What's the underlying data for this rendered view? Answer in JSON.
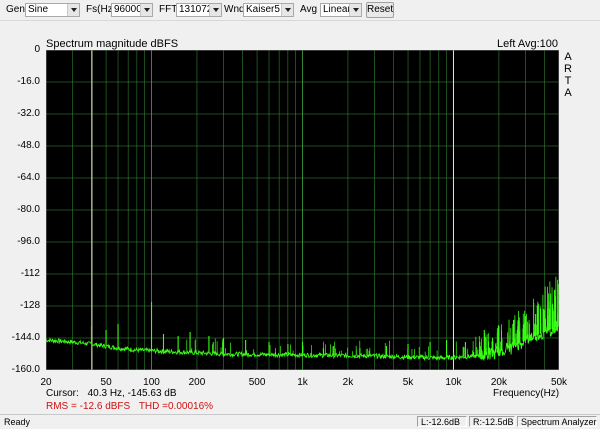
{
  "toolbar": {
    "gen_label": "Gen",
    "gen_value": "Sine",
    "fs_label": "Fs(Hz)",
    "fs_value": "96000",
    "fft_label": "FFT",
    "fft_value": "131072",
    "wnd_label": "Wnd",
    "wnd_value": "Kaiser5",
    "avg_label": "Avg",
    "avg_value": "Linear",
    "reset_label": "Reset"
  },
  "plot": {
    "title": "Spectrum magnitude dBFS",
    "channel_info": "Left  Avg:100",
    "brand_letters": [
      "A",
      "R",
      "T",
      "A"
    ],
    "x_axis_label": "Frequency(Hz)",
    "colors": {
      "background": "#000000",
      "grid": "#3a9a3a",
      "trace": "#39ff14"
    }
  },
  "chart_data": {
    "type": "line",
    "title": "Spectrum magnitude dBFS",
    "xlabel": "Frequency(Hz)",
    "ylabel": "",
    "x_scale": "log",
    "xlim": [
      20,
      50000
    ],
    "ylim": [
      -160,
      0
    ],
    "grid": true,
    "x_ticks": [
      "20",
      "50",
      "100",
      "200",
      "500",
      "1k",
      "2k",
      "5k",
      "10k",
      "20k",
      "50k"
    ],
    "y_ticks": [
      "0",
      "-16.0",
      "-32.0",
      "-48.0",
      "-64.0",
      "-80.0",
      "-96.0",
      "-112",
      "-128",
      "-144.0",
      "-160.0"
    ],
    "noise_floor": [
      [
        20,
        -145
      ],
      [
        30,
        -146
      ],
      [
        40,
        -147
      ],
      [
        60,
        -149
      ],
      [
        80,
        -150
      ],
      [
        150,
        -151
      ],
      [
        300,
        -152
      ],
      [
        1000,
        -152.5
      ],
      [
        3000,
        -153
      ],
      [
        8000,
        -154
      ],
      [
        15000,
        -153
      ],
      [
        20000,
        -151
      ],
      [
        25000,
        -148
      ],
      [
        30000,
        -145
      ],
      [
        40000,
        -141
      ],
      [
        50000,
        -138
      ]
    ],
    "peaks": [
      [
        40,
        -138
      ],
      [
        50,
        -140
      ],
      [
        60,
        -137
      ],
      [
        100,
        -126
      ],
      [
        120,
        -142
      ],
      [
        150,
        -143
      ],
      [
        180,
        -141
      ],
      [
        240,
        -143
      ],
      [
        300,
        -144
      ],
      [
        420,
        -145
      ],
      [
        600,
        -146
      ],
      [
        800,
        -147
      ],
      [
        1000,
        -146
      ],
      [
        1600,
        -148
      ],
      [
        2400,
        -149
      ],
      [
        3600,
        -148
      ],
      [
        5000,
        -147
      ],
      [
        7000,
        -146
      ],
      [
        9000,
        -145
      ],
      [
        12000,
        -146
      ],
      [
        16000,
        -140
      ],
      [
        20000,
        -138
      ],
      [
        25000,
        -135
      ],
      [
        30000,
        -133
      ],
      [
        35000,
        -132
      ],
      [
        40000,
        -130
      ],
      [
        45000,
        -128
      ],
      [
        50000,
        -126
      ]
    ],
    "marker_frequencies": [
      40.3,
      10000
    ]
  },
  "cursor": {
    "label": "Cursor:",
    "value": "40.3 Hz, -145.63 dB"
  },
  "measurement": {
    "rms": "RMS =  -12.6 dBFS",
    "thd": "THD =0.00016%"
  },
  "status": {
    "ready": "Ready",
    "left_level": "L:-12.6dB",
    "right_level": "R:-12.5dB",
    "mode": "Spectrum Analyzer"
  }
}
